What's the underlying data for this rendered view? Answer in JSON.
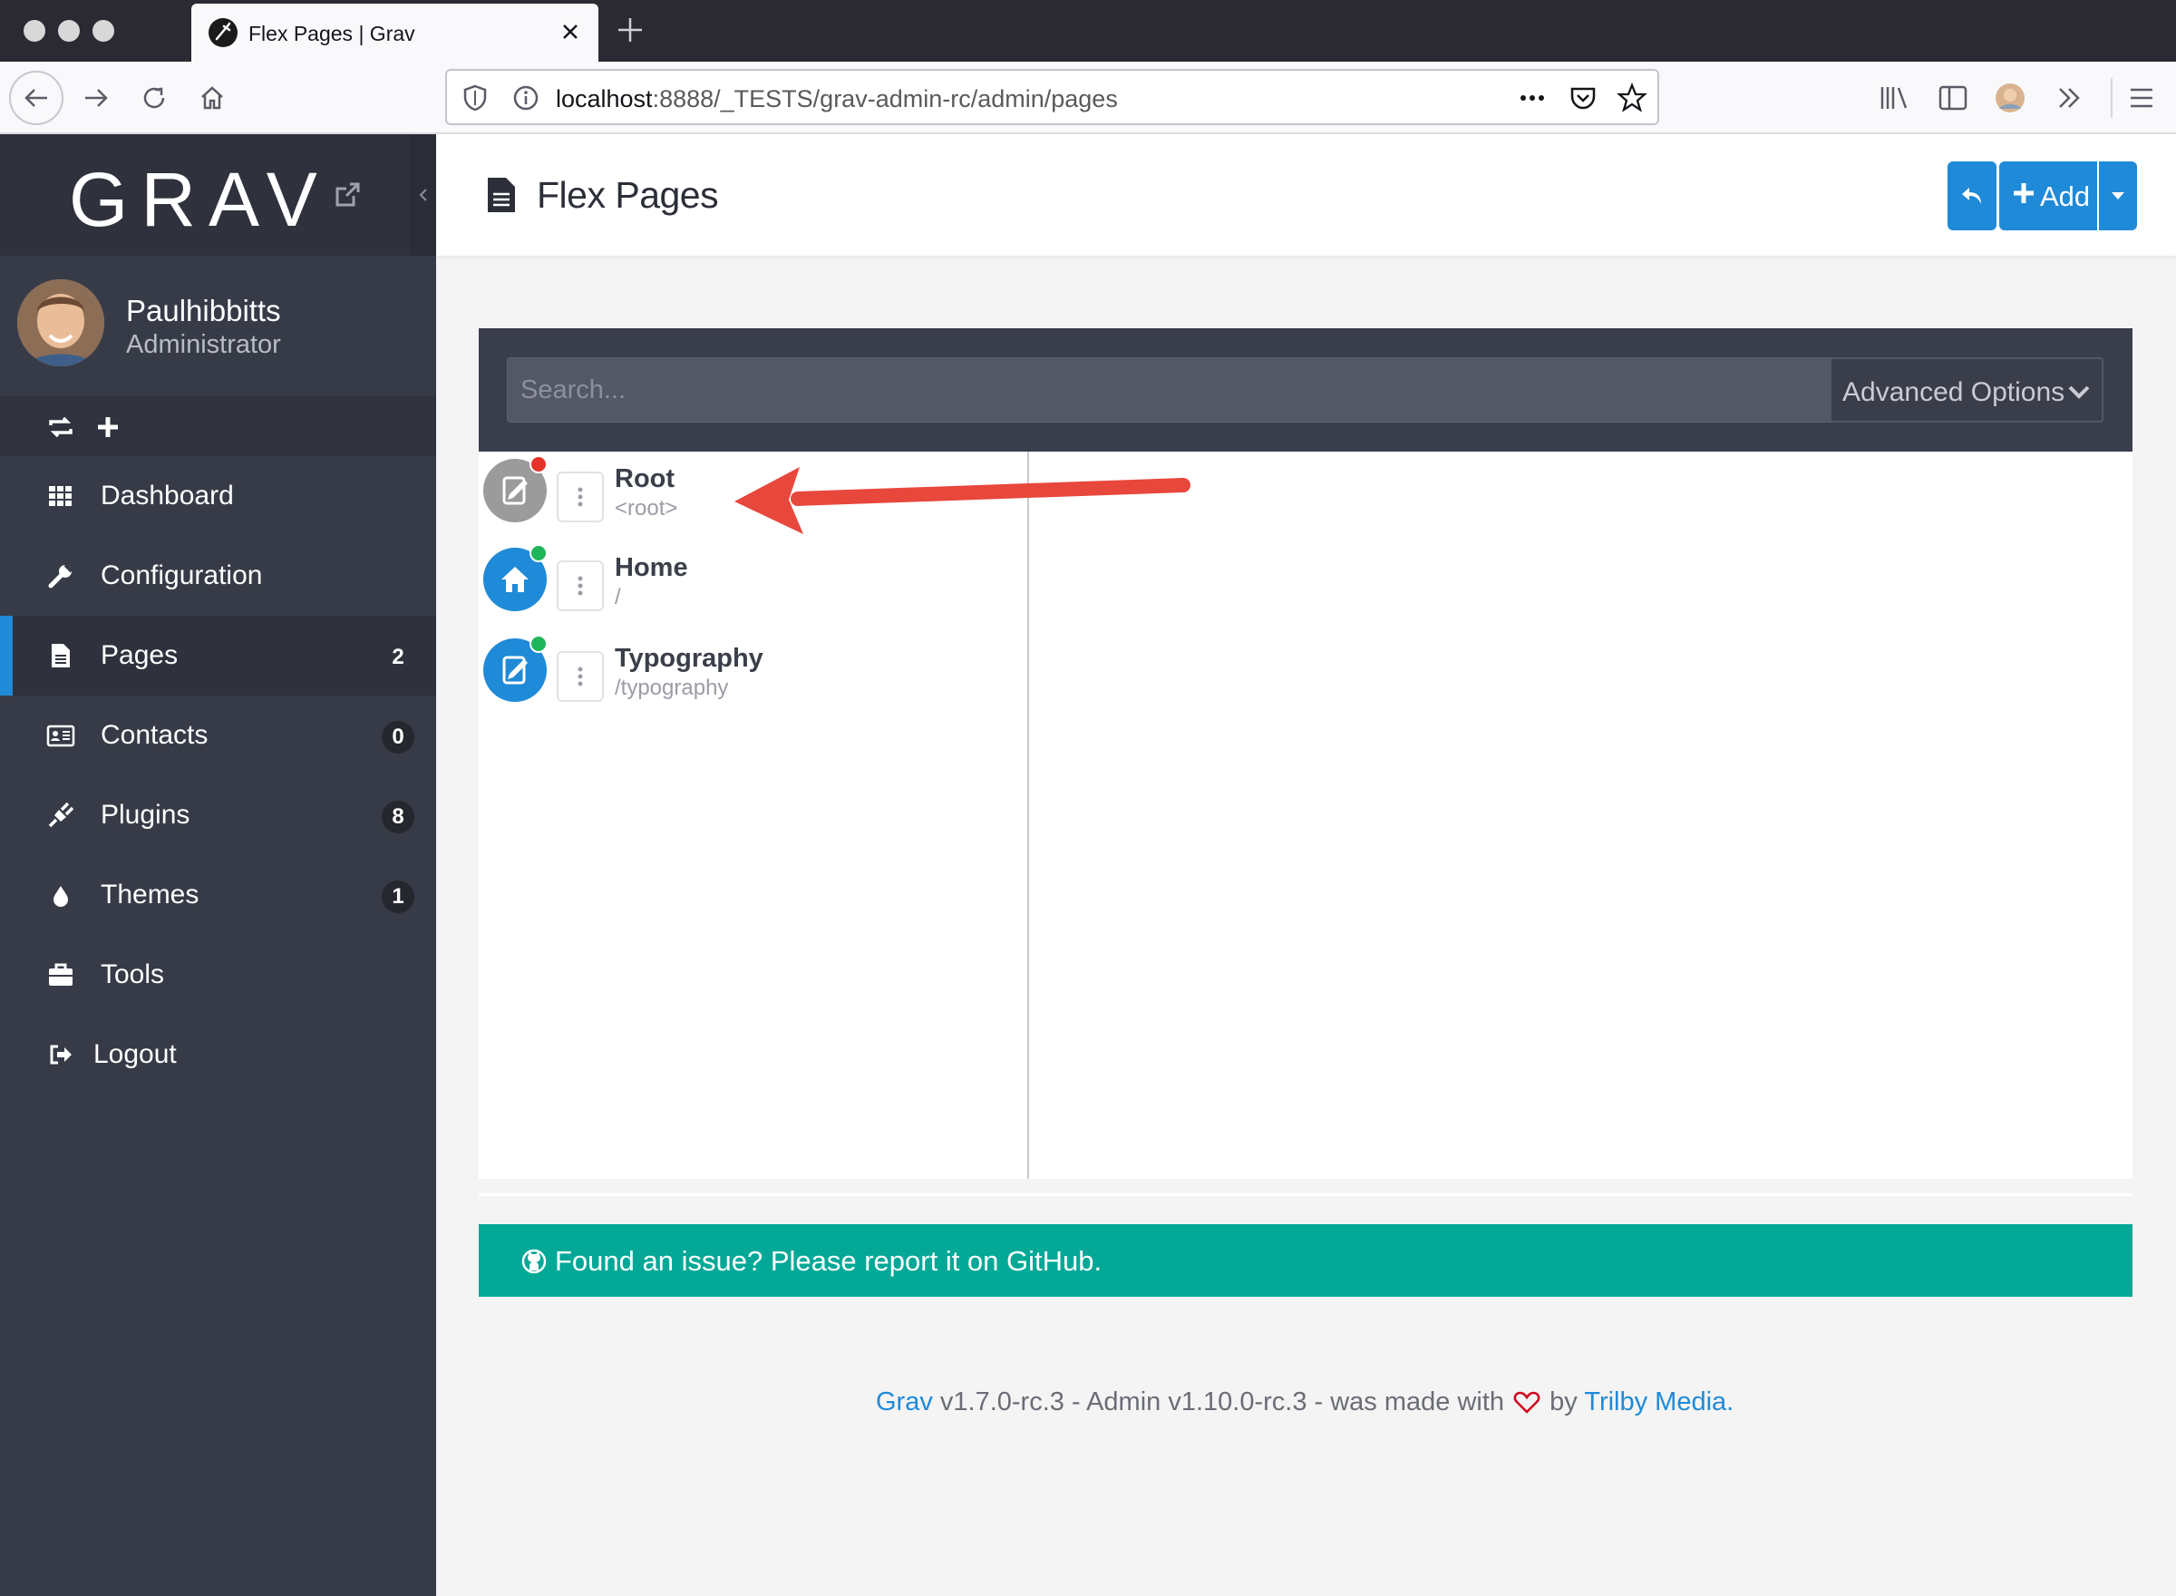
{
  "browser": {
    "tab_title": "Flex Pages | Grav",
    "url_host": "localhost",
    "url_path": ":8888/_TESTS/grav-admin-rc/admin/pages"
  },
  "sidebar": {
    "logo": "GRAV",
    "user": {
      "name": "Paulhibbitts",
      "role": "Administrator"
    },
    "items": [
      {
        "label": "Dashboard",
        "icon": "grid-icon"
      },
      {
        "label": "Configuration",
        "icon": "wrench-icon"
      },
      {
        "label": "Pages",
        "icon": "file-icon",
        "badge": "2",
        "active": true
      },
      {
        "label": "Contacts",
        "icon": "address-card-icon",
        "badge": "0"
      },
      {
        "label": "Plugins",
        "icon": "plug-icon",
        "badge": "8"
      },
      {
        "label": "Themes",
        "icon": "tint-icon",
        "badge": "1"
      },
      {
        "label": "Tools",
        "icon": "briefcase-icon"
      }
    ],
    "logout": {
      "label": "Logout",
      "icon": "sign-out-icon"
    }
  },
  "header": {
    "title": "Flex Pages",
    "add_label": "Add"
  },
  "toolbar": {
    "search_placeholder": "Search...",
    "advanced_label": "Advanced Options"
  },
  "tree": [
    {
      "title": "Root",
      "route": "<root>",
      "status": "unpublished",
      "status_color": "#e5332a",
      "icon_color": "#9b9b9b"
    },
    {
      "title": "Home",
      "route": "/",
      "status": "published",
      "status_color": "#1fb65b",
      "icon_color": "#1f8ad7"
    },
    {
      "title": "Typography",
      "route": "/typography",
      "status": "published",
      "status_color": "#1fb65b",
      "icon_color": "#1f8ad7"
    }
  ],
  "issue_bar": {
    "text": "Found an issue? Please report it on GitHub."
  },
  "footer": {
    "grav": "Grav",
    "middle": " v1.7.0-rc.3 - Admin v1.10.0-rc.3 - was made with ",
    "by": " by ",
    "trilby": "Trilby Media",
    "end": "."
  },
  "colors": {
    "accent": "#1f8ad7",
    "sidebar": "#373b47",
    "issue_bar": "#03a897",
    "annotation_arrow": "#e8473c"
  }
}
